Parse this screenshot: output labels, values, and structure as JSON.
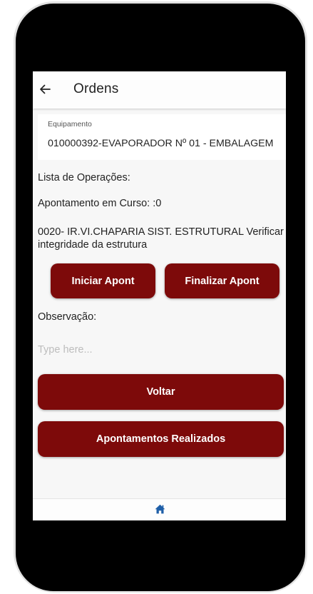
{
  "header": {
    "title": "Ordens"
  },
  "equipment": {
    "label": "Equipamento",
    "value": "010000392-EVAPORADOR Nº 01 - EMBALAGEM"
  },
  "operations_label": "Lista de Operações:",
  "current_apontamento": "Apontamento em Curso: :0",
  "operation_description": "0020- IR.VI.CHAPARIA SIST. ESTRUTURAL  Verificar integridade da estrutura",
  "buttons": {
    "start": "Iniciar Apont",
    "finish": "Finalizar Apont",
    "back": "Voltar",
    "done_list": "Apontamentos Realizados"
  },
  "observation": {
    "label": "Observação:",
    "placeholder": "Type here..."
  },
  "colors": {
    "primary": "#7d0a0a",
    "icon_blue": "#1f5fa8"
  },
  "icons": {
    "back": "arrow-left",
    "nav": "home"
  }
}
